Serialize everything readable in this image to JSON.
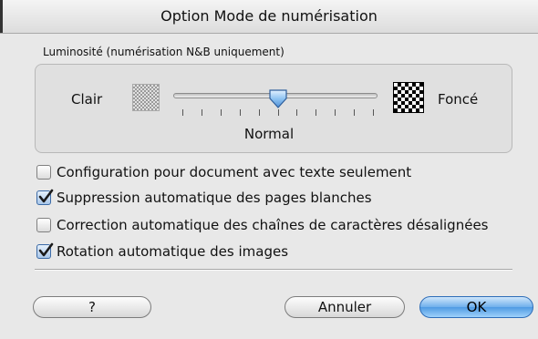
{
  "window": {
    "title": "Option Mode de numérisation"
  },
  "brightness": {
    "group_label": "Luminosité (numérisation N&B uniquement)",
    "left_label": "Clair",
    "right_label": "Foncé",
    "value_label": "Normal",
    "slider_level": 0.5,
    "tick_count": 11
  },
  "options": [
    {
      "label": "Configuration pour document avec texte seulement",
      "checked": false
    },
    {
      "label": "Suppression automatique des pages blanches",
      "checked": true
    },
    {
      "label": "Correction automatique des chaînes de caractères désalignées",
      "checked": false
    },
    {
      "label": "Rotation automatique des images",
      "checked": true
    }
  ],
  "buttons": {
    "help": "?",
    "cancel": "Annuler",
    "ok": "OK"
  },
  "colors": {
    "accent": "#4f9ae3",
    "check": "#1a1a1a"
  },
  "icons": {
    "light": "light-pattern-icon",
    "dark": "dark-pattern-icon",
    "thumb": "slider-thumb-icon",
    "check": "checkmark-icon"
  }
}
